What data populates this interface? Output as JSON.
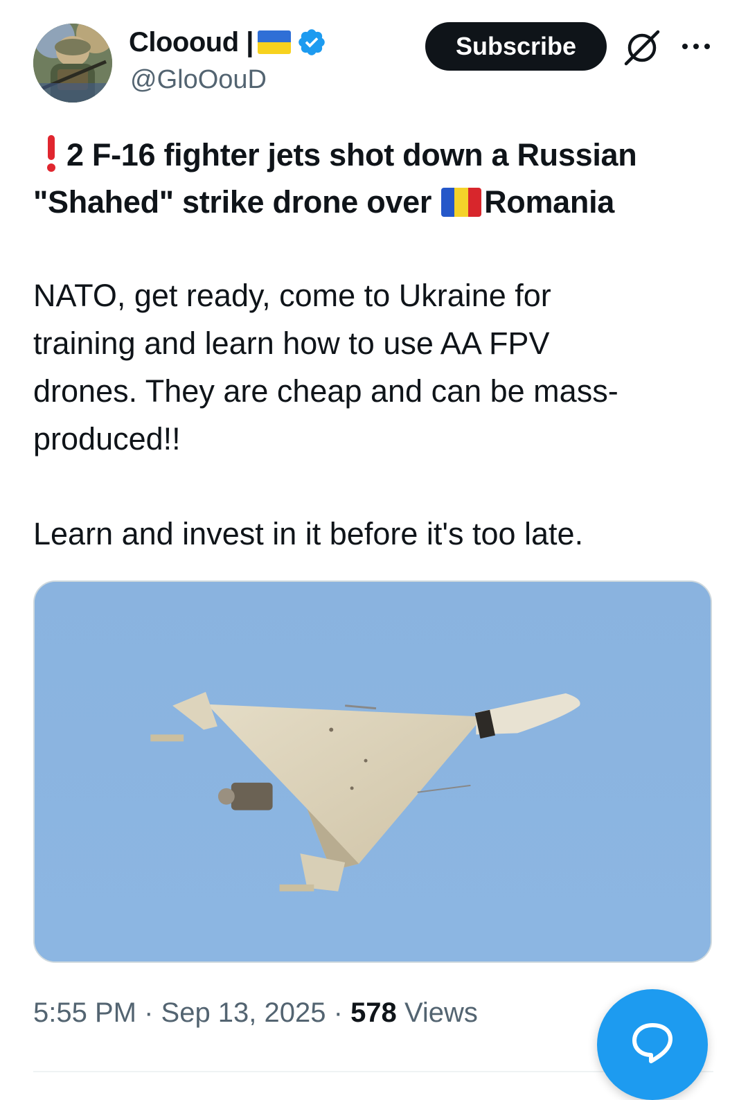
{
  "author": {
    "display_name": "Clooοud |",
    "handle": "@GloOouD",
    "verified": true
  },
  "subscribe_label": "Subscribe",
  "post": {
    "headline_line1": "2 F-16 fighter jets shot down a Russian",
    "headline_line2": "\"Shahed\" strike drone over",
    "headline_country": "Romania",
    "paragraph1_lines": [
      "NATO, get ready, come to Ukraine for",
      "training and learn how to use AA FPV",
      "drones. They are cheap and can be mass-",
      "produced!!"
    ],
    "paragraph2": "Learn and invest in it before it's too late."
  },
  "meta": {
    "time": "5:55 PM",
    "separator": " · ",
    "date": "Sep 13, 2025",
    "views_count": "578",
    "views_label": "Views"
  },
  "icons": {
    "verified": "verified-badge-icon",
    "grok": "grok-icon",
    "more": "more-options-icon",
    "reply_fab": "chat-bubble-icon"
  },
  "colors": {
    "accent": "#1d9bf0",
    "text": "#0f1419",
    "secondary": "#536471",
    "exclamation": "#e0262f"
  }
}
